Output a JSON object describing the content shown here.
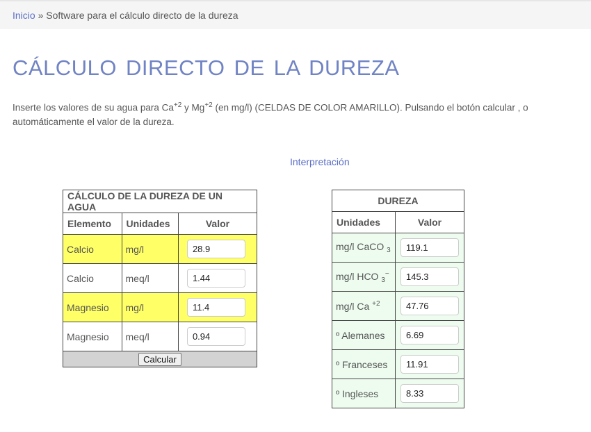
{
  "breadcrumb": {
    "home": "Inicio",
    "separator": "»",
    "current": "Software para el cálculo directo de la dureza"
  },
  "page_title": "CÁLCULO DIRECTO DE LA DUREZA",
  "intro": {
    "part1": "Inserte los valores de su agua para Ca",
    "sup1": "+2",
    "part2": " y Mg",
    "sup2": "+2",
    "part3": " (en mg/l) (CELDAS DE COLOR AMARILLO). Pulsando el botón calcular , o",
    "line2": "automáticamente el valor de la dureza."
  },
  "interpretation_link": "Interpretación",
  "calc_table": {
    "title": "CÁLCULO DE LA DUREZA DE UN AGUA",
    "headers": [
      "Elemento",
      "Unidades",
      "Valor"
    ],
    "rows": [
      {
        "element": "Calcio",
        "unit": "mg/l",
        "value": "28.9"
      },
      {
        "element": "Calcio",
        "unit": "meq/l",
        "value": "1.44"
      },
      {
        "element": "Magnesio",
        "unit": "mg/l",
        "value": "11.4"
      },
      {
        "element": "Magnesio",
        "unit": "meq/l",
        "value": "0.94"
      }
    ],
    "button": "Calcular"
  },
  "hardness_table": {
    "title": "DUREZA",
    "headers": [
      "Unidades",
      "Valor"
    ],
    "rows": [
      {
        "unit": "mg/l CaCO",
        "unit_sub": "3",
        "value": "119.1"
      },
      {
        "unit": "mg/l HCO",
        "unit_sub": "3",
        "unit_sup": "−",
        "value": "145.3"
      },
      {
        "unit": "mg/l Ca",
        "unit_sup": "+2",
        "value": "47.76"
      },
      {
        "unit": "º Alemanes",
        "value": "6.69"
      },
      {
        "unit": "º Franceses",
        "value": "11.91"
      },
      {
        "unit": "º Ingleses",
        "value": "8.33"
      }
    ]
  },
  "colors": {
    "link": "#5a6ec7",
    "title": "#7083c4",
    "input_highlight": "#ffff66",
    "result_cell": "#eefcef"
  }
}
